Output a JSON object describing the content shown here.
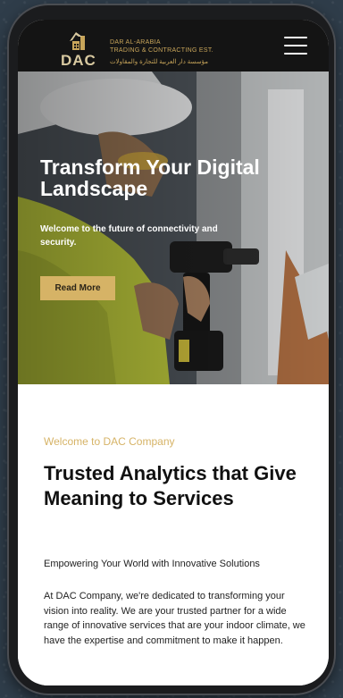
{
  "header": {
    "logo_mark": "DAC",
    "logo_line1": "DAR AL-ARABIA",
    "logo_line2": "TRADING & CONTRACTING EST.",
    "logo_line3": "مؤسسة دار العربية للتجارة والمقاولات",
    "menu_icon": "hamburger-icon"
  },
  "hero": {
    "title": "Transform Your Digital Landscape",
    "subtitle": "Welcome to the future of connectivity and security.",
    "button_label": "Read More"
  },
  "intro": {
    "eyebrow": "Welcome to DAC Company",
    "headline": "Trusted Analytics that Give Meaning to Services",
    "tagline": "Empowering Your World with Innovative Solutions",
    "paragraph": "At DAC Company, we're dedicated to transforming your vision into reality. We are your trusted partner for a wide range of innovative services that are your indoor climate, we have the expertise and commitment to make it happen."
  },
  "colors": {
    "accent": "#d6b366",
    "header_bg": "#141414",
    "text_dark": "#111111"
  }
}
